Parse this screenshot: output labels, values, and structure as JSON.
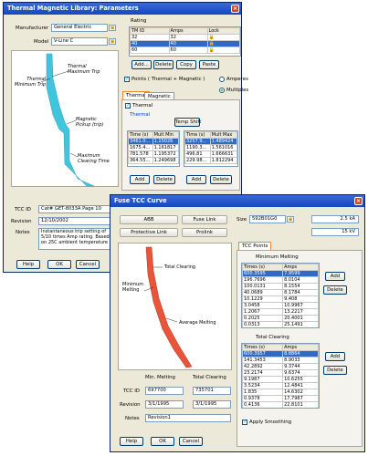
{
  "thermal_window": {
    "title": "Thermal Magnetic Library: Parameters",
    "manufacturer_label": "Manufacturer",
    "manufacturer_value": "General Electric",
    "model_label": "Model",
    "model_value": "V-Line C",
    "rating_label": "Rating",
    "rating_headers": [
      "TM ID",
      "Amps",
      "Lock"
    ],
    "rating_rows": [
      [
        "32",
        "32"
      ],
      [
        "40",
        "40"
      ],
      [
        "60",
        "60"
      ]
    ],
    "rating_buttons": [
      "Add...",
      "Delete",
      "Copy",
      "Paste"
    ],
    "points_label": "Points ( Thermal + Magnetic )",
    "amperes_label": "Amperes",
    "multiples_label": "Multiples",
    "tabs": [
      "Thermal",
      "Magnetic"
    ],
    "thermal_check_label": "Thermal",
    "thermal_group_label": "Thermal",
    "temp_shift_label": "Temp Shift",
    "min_headers": [
      "Time (s)",
      "Mult Min"
    ],
    "min_rows": [
      [
        "3461.0...",
        "1.15026"
      ],
      [
        "1675.4...",
        "1.161817"
      ],
      [
        "781.578",
        "1.195372"
      ],
      [
        "364.55...",
        "1.249698"
      ]
    ],
    "max_headers": [
      "Time (s)",
      "Mult Max"
    ],
    "max_rows": [
      [
        "3257.9...",
        "1.489424"
      ],
      [
        "1190.3...",
        "1.561016"
      ],
      [
        "496.81",
        "1.666631"
      ],
      [
        "229.98...",
        "1.812294"
      ]
    ],
    "add_label": "Add",
    "delete_label": "Delete",
    "curve_labels": {
      "thermal_min": "Thermal\nMinimum Trip",
      "thermal_max": "Thermal\nMaximum Trip",
      "magnetic": "Magnetic\nPickup (trip)",
      "max_clearing": "Maximum\nClearing Time"
    },
    "tcc_id_label": "TCC ID",
    "tcc_id_value": "Cat# GET-8033A Page 10",
    "revision_label": "Revision",
    "revision_value": "12/10/2002",
    "notes_label": "Notes",
    "notes_value": "Instantaneous trip setting of 5/10 times Amp rating. Based on 25C ambient temperature",
    "help_label": "Help",
    "ok_label": "OK",
    "cancel_label": "Cancel"
  },
  "fuse_window": {
    "title": "Fuse TCC Curve",
    "row1": [
      "ABB",
      "Fuse Link",
      "Size",
      "592B01G0",
      "2.5 kA"
    ],
    "row2": [
      "Protective Link",
      "Prolink",
      "15 kV"
    ],
    "tab_label": "TCC Points",
    "min_melting_label": "Minimum Melting",
    "min_headers": [
      "Times (s)",
      "Amps"
    ],
    "min_rows": [
      [
        "600.3595",
        "7.9599"
      ],
      [
        "196.7696",
        "8.0104"
      ],
      [
        "100.0131",
        "8.1554"
      ],
      [
        "40.0689",
        "8.1784"
      ],
      [
        "10.1229",
        "9.408"
      ],
      [
        "3.0458",
        "10.9967"
      ],
      [
        "1.2067",
        "13.2217"
      ],
      [
        "0.2025",
        "20.4001"
      ],
      [
        "0.0313",
        "25.1491"
      ]
    ],
    "total_clearing_label": "Total Clearing",
    "tc_headers": [
      "Times (s)",
      "Amps"
    ],
    "tc_rows": [
      [
        "600.3957",
        "8.8864"
      ],
      [
        "141.3453",
        "8.9033"
      ],
      [
        "42.2892",
        "9.3744"
      ],
      [
        "23.2174",
        "9.6374"
      ],
      [
        "9.1987",
        "10.6255"
      ],
      [
        "3.5234",
        "12.4841"
      ],
      [
        "1.835",
        "14.6302"
      ],
      [
        "0.9378",
        "17.7987"
      ],
      [
        "0.4136",
        "22.8101"
      ]
    ],
    "add_label": "Add",
    "delete_label": "Delete",
    "apply_smoothing_label": "Apply Smoothing",
    "curve_labels": {
      "total": "Total Clearing",
      "min": "Minimum\nMelting",
      "avg": "Average Melting"
    },
    "col_min": "Min. Melting",
    "col_total": "Total Clearing",
    "tcc_id_label": "TCC ID",
    "tcc_id_min": "697700",
    "tcc_id_total": "735701",
    "revision_label": "Revision",
    "revision_min": "3/1/1995",
    "revision_total": "3/1/1995",
    "notes_label": "Notes",
    "notes_value": "Revision1",
    "help_label": "Help",
    "ok_label": "OK",
    "cancel_label": "Cancel"
  },
  "colors": {
    "titlebar": "#1447c0",
    "thermal_curve": "#3fc6de",
    "fuse_curve": "#e8553a"
  }
}
